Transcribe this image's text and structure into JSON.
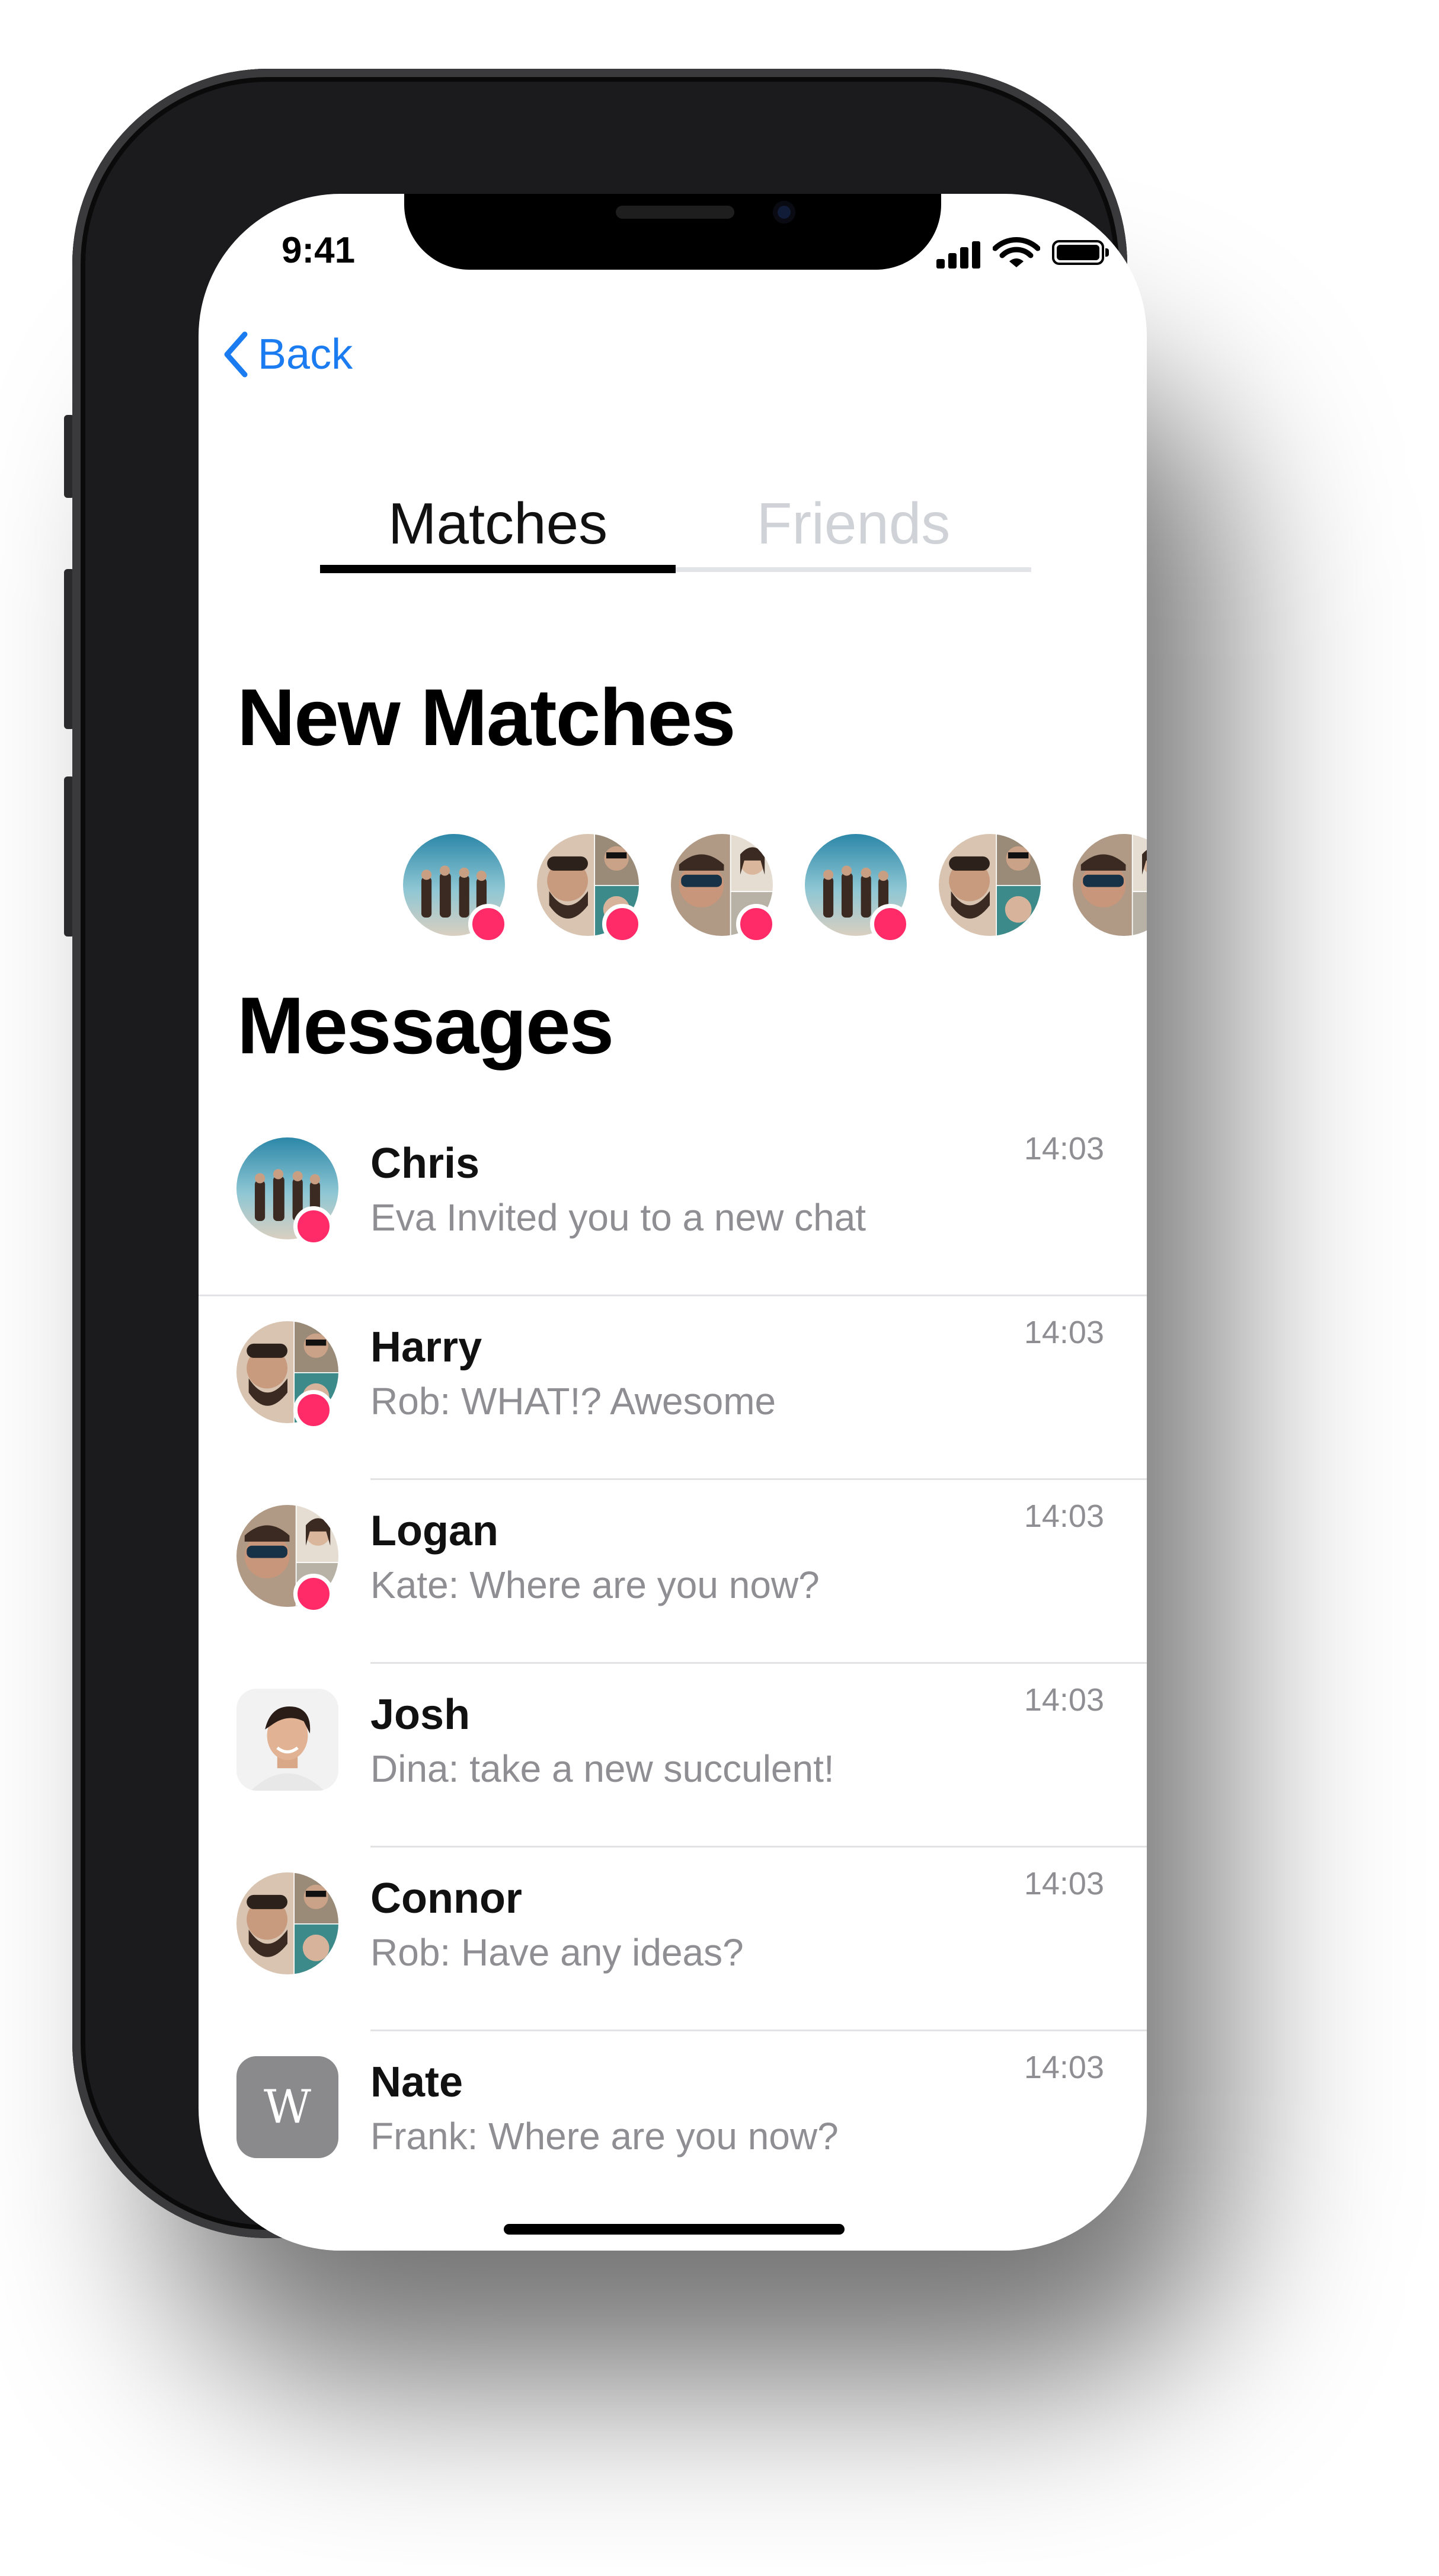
{
  "status_bar": {
    "time": "9:41"
  },
  "nav": {
    "back_label": "Back"
  },
  "tabs": [
    {
      "label": "Matches",
      "active": true
    },
    {
      "label": "Friends",
      "active": false
    }
  ],
  "sections": {
    "new_matches_title": "New Matches",
    "messages_title": "Messages"
  },
  "new_matches": [
    {
      "avatar": "group-photo-teal",
      "unread": true
    },
    {
      "avatar": "collage-beard",
      "unread": true
    },
    {
      "avatar": "collage-sunglasses",
      "unread": true
    },
    {
      "avatar": "group-photo-teal",
      "unread": true
    },
    {
      "avatar": "collage-beard",
      "unread": false
    },
    {
      "avatar": "collage-sunglasses",
      "unread": false
    }
  ],
  "messages": [
    {
      "name": "Chris",
      "preview": "Eva Invited you to a new chat",
      "time": "14:03",
      "avatar": "group-photo-teal",
      "unread": true
    },
    {
      "name": "Harry",
      "preview": "Rob: WHAT!? Awesome",
      "time": "14:03",
      "avatar": "collage-beard",
      "unread": true
    },
    {
      "name": "Logan",
      "preview": "Kate: Where are you now?",
      "time": "14:03",
      "avatar": "collage-sunglasses",
      "unread": true
    },
    {
      "name": "Josh",
      "preview": "Dina: take a new succulent!",
      "time": "14:03",
      "avatar": "portrait-photo",
      "unread": false
    },
    {
      "name": "Connor",
      "preview": "Rob: Have any ideas?",
      "time": "14:03",
      "avatar": "collage-beard",
      "unread": false
    },
    {
      "name": "Nate",
      "preview": "Frank: Where are you now?",
      "time": "14:03",
      "avatar": "w-logo",
      "avatar_letter": "W",
      "unread": false
    }
  ],
  "colors": {
    "accent": "#1a7cf0",
    "unread_dot": "#ff2a68",
    "secondary_text": "#8e8e93",
    "tab_inactive": "#cfd2d6"
  }
}
